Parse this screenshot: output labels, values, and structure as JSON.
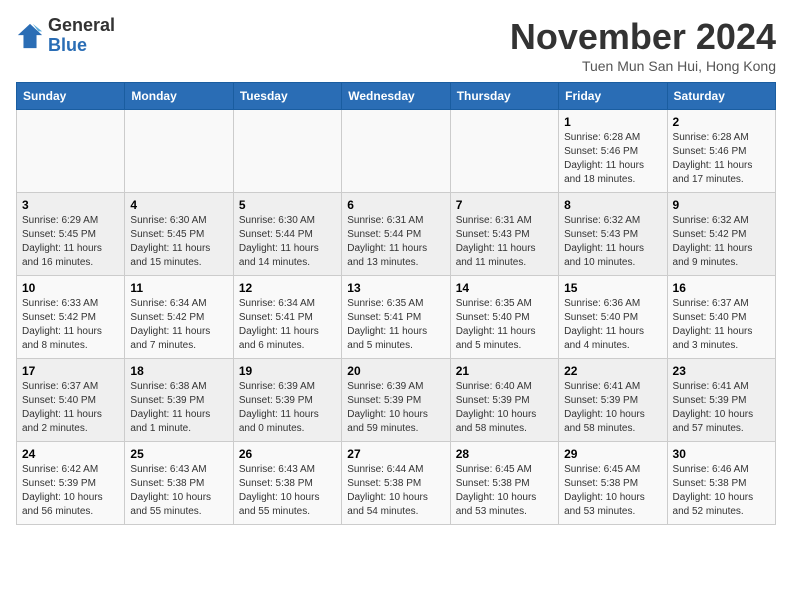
{
  "header": {
    "logo_general": "General",
    "logo_blue": "Blue",
    "month_title": "November 2024",
    "subtitle": "Tuen Mun San Hui, Hong Kong"
  },
  "days_of_week": [
    "Sunday",
    "Monday",
    "Tuesday",
    "Wednesday",
    "Thursday",
    "Friday",
    "Saturday"
  ],
  "weeks": [
    [
      {
        "day": "",
        "info": ""
      },
      {
        "day": "",
        "info": ""
      },
      {
        "day": "",
        "info": ""
      },
      {
        "day": "",
        "info": ""
      },
      {
        "day": "",
        "info": ""
      },
      {
        "day": "1",
        "info": "Sunrise: 6:28 AM\nSunset: 5:46 PM\nDaylight: 11 hours\nand 18 minutes."
      },
      {
        "day": "2",
        "info": "Sunrise: 6:28 AM\nSunset: 5:46 PM\nDaylight: 11 hours\nand 17 minutes."
      }
    ],
    [
      {
        "day": "3",
        "info": "Sunrise: 6:29 AM\nSunset: 5:45 PM\nDaylight: 11 hours\nand 16 minutes."
      },
      {
        "day": "4",
        "info": "Sunrise: 6:30 AM\nSunset: 5:45 PM\nDaylight: 11 hours\nand 15 minutes."
      },
      {
        "day": "5",
        "info": "Sunrise: 6:30 AM\nSunset: 5:44 PM\nDaylight: 11 hours\nand 14 minutes."
      },
      {
        "day": "6",
        "info": "Sunrise: 6:31 AM\nSunset: 5:44 PM\nDaylight: 11 hours\nand 13 minutes."
      },
      {
        "day": "7",
        "info": "Sunrise: 6:31 AM\nSunset: 5:43 PM\nDaylight: 11 hours\nand 11 minutes."
      },
      {
        "day": "8",
        "info": "Sunrise: 6:32 AM\nSunset: 5:43 PM\nDaylight: 11 hours\nand 10 minutes."
      },
      {
        "day": "9",
        "info": "Sunrise: 6:32 AM\nSunset: 5:42 PM\nDaylight: 11 hours\nand 9 minutes."
      }
    ],
    [
      {
        "day": "10",
        "info": "Sunrise: 6:33 AM\nSunset: 5:42 PM\nDaylight: 11 hours\nand 8 minutes."
      },
      {
        "day": "11",
        "info": "Sunrise: 6:34 AM\nSunset: 5:42 PM\nDaylight: 11 hours\nand 7 minutes."
      },
      {
        "day": "12",
        "info": "Sunrise: 6:34 AM\nSunset: 5:41 PM\nDaylight: 11 hours\nand 6 minutes."
      },
      {
        "day": "13",
        "info": "Sunrise: 6:35 AM\nSunset: 5:41 PM\nDaylight: 11 hours\nand 5 minutes."
      },
      {
        "day": "14",
        "info": "Sunrise: 6:35 AM\nSunset: 5:40 PM\nDaylight: 11 hours\nand 5 minutes."
      },
      {
        "day": "15",
        "info": "Sunrise: 6:36 AM\nSunset: 5:40 PM\nDaylight: 11 hours\nand 4 minutes."
      },
      {
        "day": "16",
        "info": "Sunrise: 6:37 AM\nSunset: 5:40 PM\nDaylight: 11 hours\nand 3 minutes."
      }
    ],
    [
      {
        "day": "17",
        "info": "Sunrise: 6:37 AM\nSunset: 5:40 PM\nDaylight: 11 hours\nand 2 minutes."
      },
      {
        "day": "18",
        "info": "Sunrise: 6:38 AM\nSunset: 5:39 PM\nDaylight: 11 hours\nand 1 minute."
      },
      {
        "day": "19",
        "info": "Sunrise: 6:39 AM\nSunset: 5:39 PM\nDaylight: 11 hours\nand 0 minutes."
      },
      {
        "day": "20",
        "info": "Sunrise: 6:39 AM\nSunset: 5:39 PM\nDaylight: 10 hours\nand 59 minutes."
      },
      {
        "day": "21",
        "info": "Sunrise: 6:40 AM\nSunset: 5:39 PM\nDaylight: 10 hours\nand 58 minutes."
      },
      {
        "day": "22",
        "info": "Sunrise: 6:41 AM\nSunset: 5:39 PM\nDaylight: 10 hours\nand 58 minutes."
      },
      {
        "day": "23",
        "info": "Sunrise: 6:41 AM\nSunset: 5:39 PM\nDaylight: 10 hours\nand 57 minutes."
      }
    ],
    [
      {
        "day": "24",
        "info": "Sunrise: 6:42 AM\nSunset: 5:39 PM\nDaylight: 10 hours\nand 56 minutes."
      },
      {
        "day": "25",
        "info": "Sunrise: 6:43 AM\nSunset: 5:38 PM\nDaylight: 10 hours\nand 55 minutes."
      },
      {
        "day": "26",
        "info": "Sunrise: 6:43 AM\nSunset: 5:38 PM\nDaylight: 10 hours\nand 55 minutes."
      },
      {
        "day": "27",
        "info": "Sunrise: 6:44 AM\nSunset: 5:38 PM\nDaylight: 10 hours\nand 54 minutes."
      },
      {
        "day": "28",
        "info": "Sunrise: 6:45 AM\nSunset: 5:38 PM\nDaylight: 10 hours\nand 53 minutes."
      },
      {
        "day": "29",
        "info": "Sunrise: 6:45 AM\nSunset: 5:38 PM\nDaylight: 10 hours\nand 53 minutes."
      },
      {
        "day": "30",
        "info": "Sunrise: 6:46 AM\nSunset: 5:38 PM\nDaylight: 10 hours\nand 52 minutes."
      }
    ]
  ]
}
